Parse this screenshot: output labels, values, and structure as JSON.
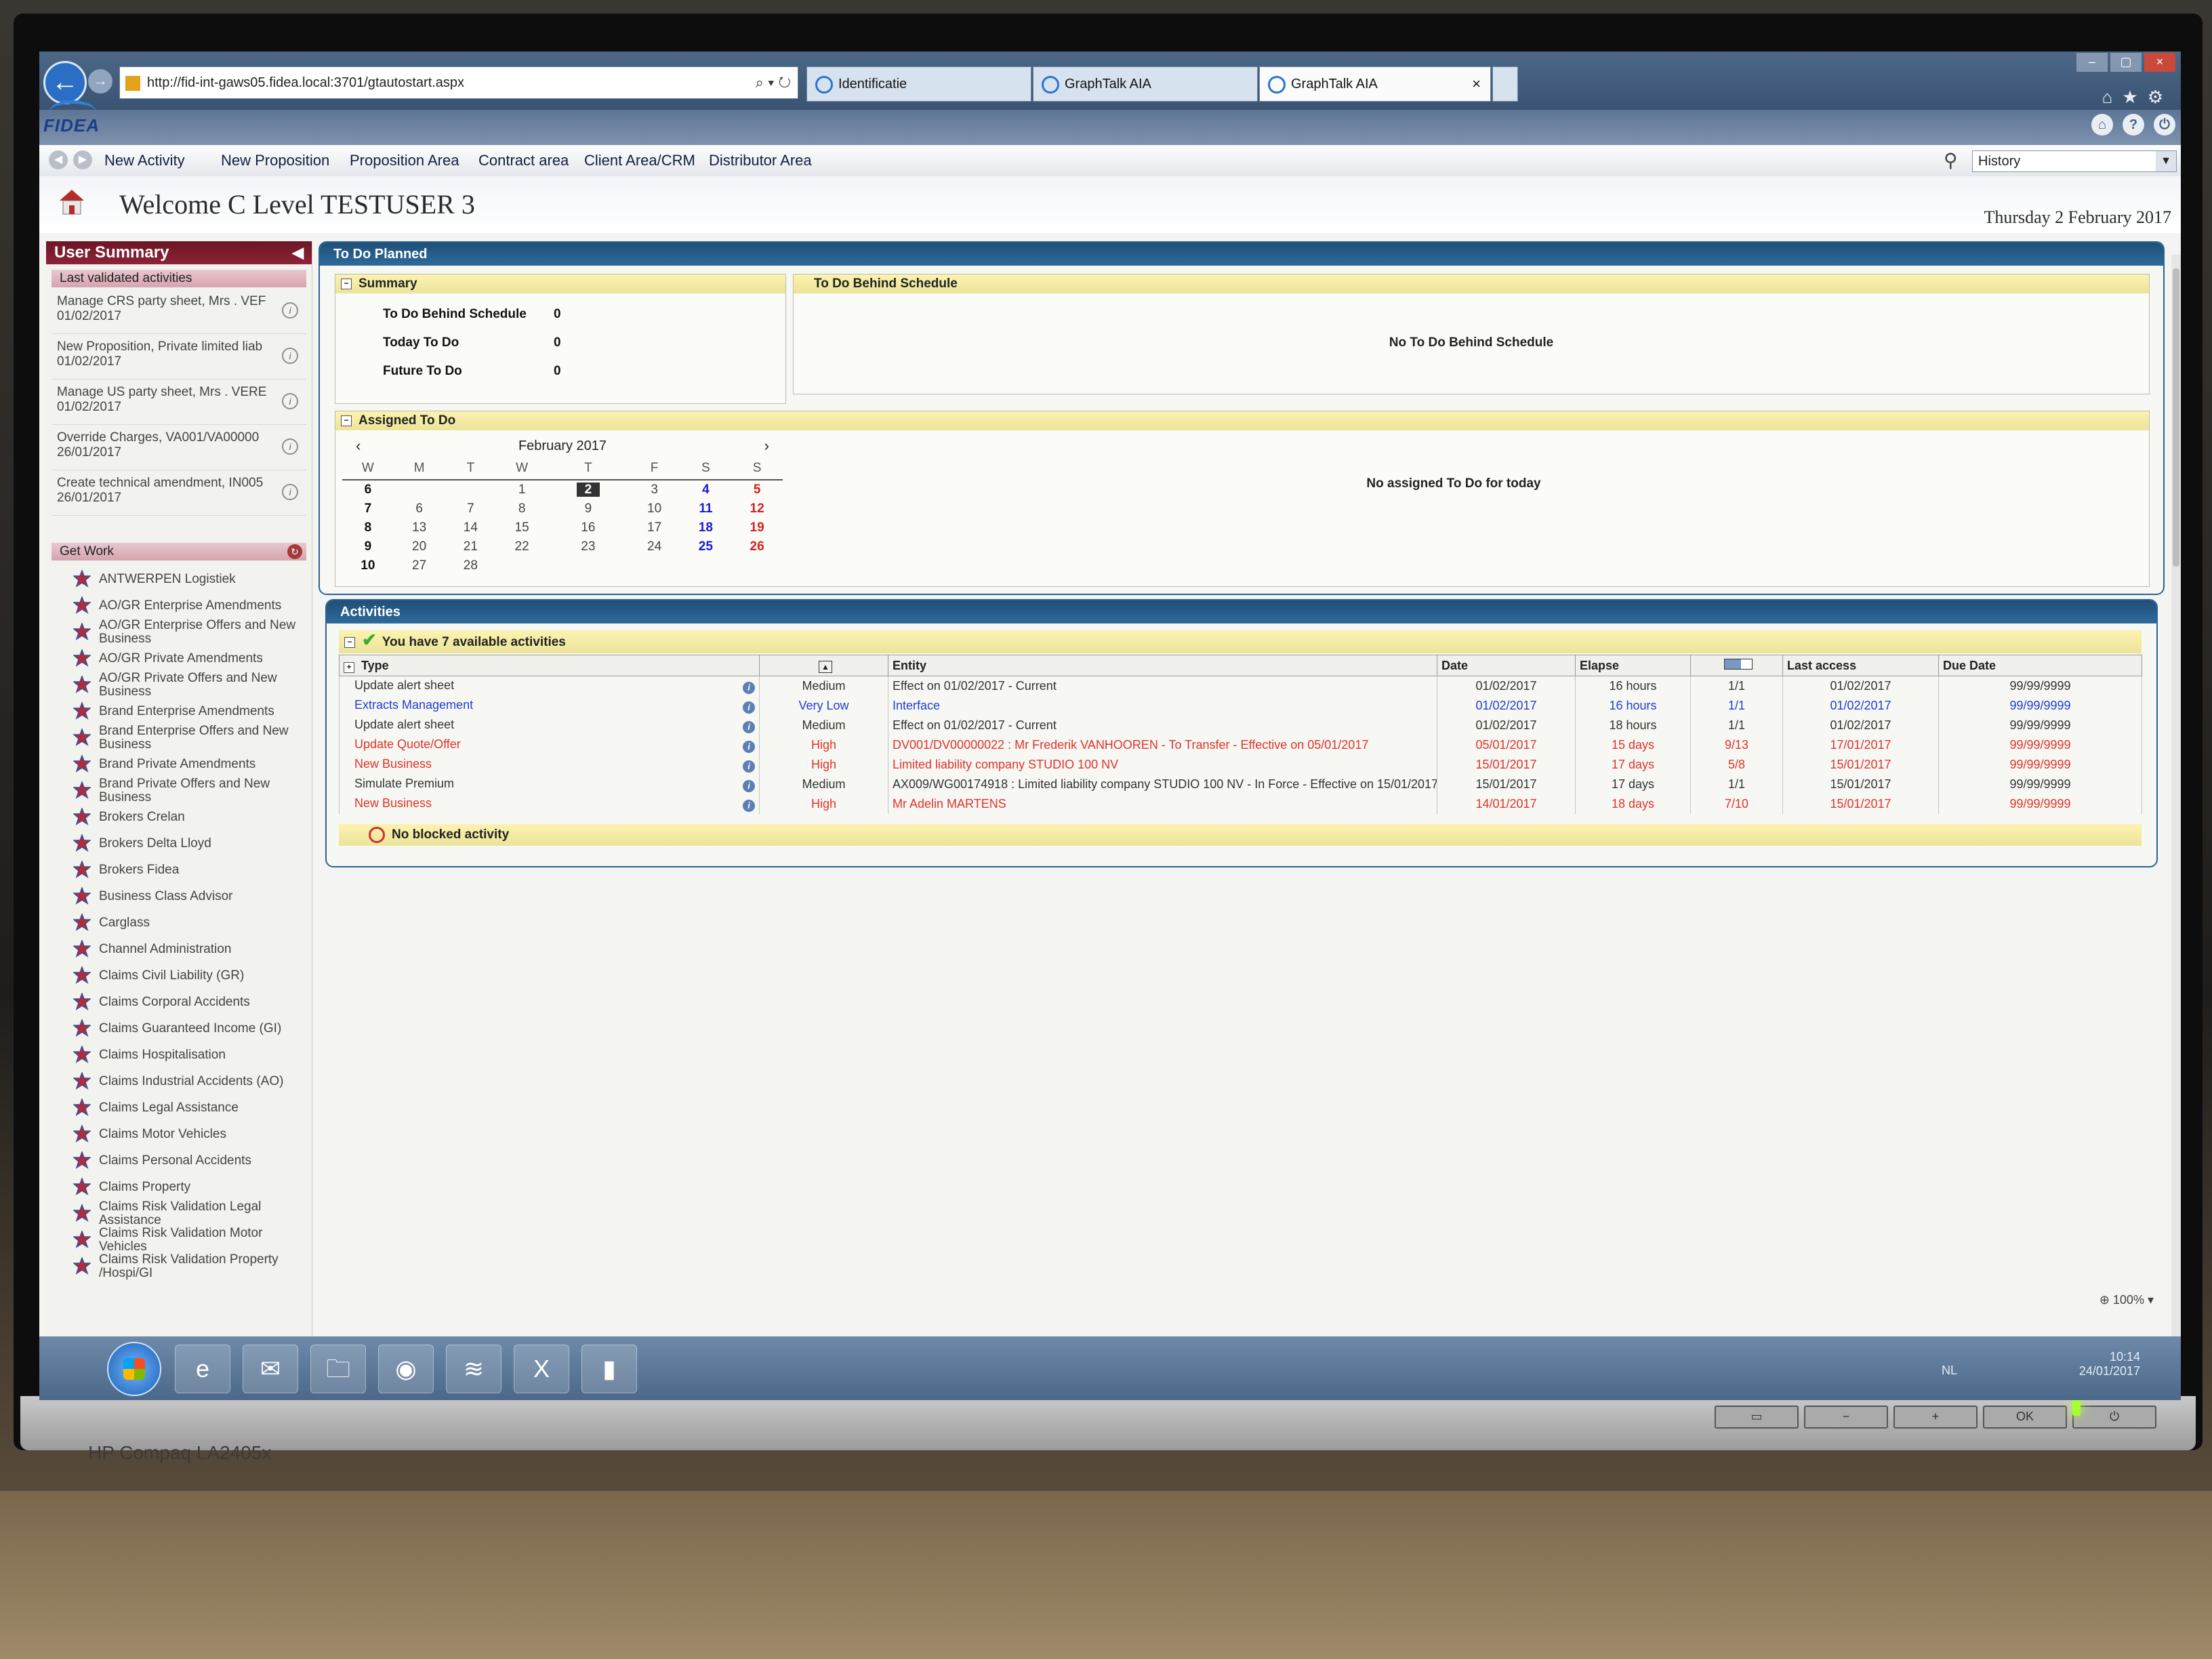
{
  "browser": {
    "url": "http://fid-int-gaws05.fidea.local:3701/gtautostart.aspx",
    "tabs": [
      {
        "label": "Identificatie",
        "active": false
      },
      {
        "label": "GraphTalk AIA",
        "active": false
      },
      {
        "label": "GraphTalk AIA",
        "active": true
      }
    ]
  },
  "app": {
    "logo": "FIDEA",
    "menu": [
      "New Activity",
      "New Proposition",
      "Proposition Area",
      "Contract area",
      "Client Area/CRM",
      "Distributor Area"
    ],
    "history_placeholder": "History",
    "welcome": "Welcome C Level TESTUSER 3",
    "date": "Thursday 2 February 2017"
  },
  "sidebar": {
    "title": "User Summary",
    "last_validated_title": "Last validated activities",
    "recent": [
      {
        "text": "Manage CRS party sheet, Mrs . VEF",
        "date": "01/02/2017"
      },
      {
        "text": "New Proposition, Private limited liab",
        "date": "01/02/2017"
      },
      {
        "text": "Manage US party sheet, Mrs . VERE",
        "date": "01/02/2017"
      },
      {
        "text": "Override Charges, VA001/VA00000",
        "date": "26/01/2017"
      },
      {
        "text": "Create technical amendment, IN005",
        "date": "26/01/2017"
      }
    ],
    "get_work_title": "Get Work",
    "get_work": [
      "ANTWERPEN Logistiek",
      "AO/GR Enterprise Amendments",
      "AO/GR Enterprise Offers and New Business",
      "AO/GR Private Amendments",
      "AO/GR Private Offers and New Business",
      "Brand Enterprise Amendments",
      "Brand Enterprise Offers and New Business",
      "Brand Private Amendments",
      "Brand Private Offers and New Business",
      "Brokers Crelan",
      "Brokers Delta Lloyd",
      "Brokers Fidea",
      "Business Class Advisor",
      "Carglass",
      "Channel Administration",
      "Claims Civil Liability (GR)",
      "Claims Corporal Accidents",
      "Claims Guaranteed Income (GI)",
      "Claims Hospitalisation",
      "Claims Industrial Accidents (AO)",
      "Claims Legal Assistance",
      "Claims Motor Vehicles",
      "Claims Personal Accidents",
      "Claims Property",
      "Claims Risk Validation Legal Assistance",
      "Claims Risk Validation Motor Vehicles",
      "Claims Risk Validation Property /Hospi/GI"
    ]
  },
  "todo": {
    "title": "To Do Planned",
    "summary_title": "Summary",
    "summary": [
      {
        "label": "To Do Behind Schedule",
        "value": "0"
      },
      {
        "label": "Today To Do",
        "value": "0"
      },
      {
        "label": "Future To Do",
        "value": "0"
      }
    ],
    "behind_title": "To Do Behind Schedule",
    "behind_msg": "No To Do Behind Schedule",
    "assigned_title": "Assigned To Do",
    "assigned_msg": "No assigned To Do for today",
    "calendar": {
      "month": "February 2017",
      "headers": [
        "W",
        "M",
        "T",
        "W",
        "T",
        "F",
        "S",
        "S"
      ],
      "weeks": [
        [
          "6",
          "",
          "",
          "1",
          "2",
          "3",
          "4",
          "5"
        ],
        [
          "7",
          "6",
          "7",
          "8",
          "9",
          "10",
          "11",
          "12"
        ],
        [
          "8",
          "13",
          "14",
          "15",
          "16",
          "17",
          "18",
          "19"
        ],
        [
          "9",
          "20",
          "21",
          "22",
          "23",
          "24",
          "25",
          "26"
        ],
        [
          "10",
          "27",
          "28",
          "",
          "",
          "",
          "",
          ""
        ]
      ],
      "today": "2"
    }
  },
  "activities": {
    "title": "Activities",
    "available": "You have 7 available activities",
    "columns": [
      "Type",
      "",
      "",
      "Entity",
      "Date",
      "Elapse",
      "",
      "Last access",
      "Due Date"
    ],
    "rows": [
      {
        "type": "Update alert sheet",
        "priority": "Medium",
        "entity": "Effect on 01/02/2017 - Current",
        "date": "01/02/2017",
        "elapse": "16 hours",
        "ratio": "1/1",
        "last": "01/02/2017",
        "due": "99/99/9999",
        "style": "normal"
      },
      {
        "type": "Extracts Management",
        "priority": "Very Low",
        "entity": "Interface",
        "date": "01/02/2017",
        "elapse": "16 hours",
        "ratio": "1/1",
        "last": "01/02/2017",
        "due": "99/99/9999",
        "style": "blue"
      },
      {
        "type": "Update alert sheet",
        "priority": "Medium",
        "entity": "Effect on 01/02/2017 - Current",
        "date": "01/02/2017",
        "elapse": "18 hours",
        "ratio": "1/1",
        "last": "01/02/2017",
        "due": "99/99/9999",
        "style": "normal"
      },
      {
        "type": "Update Quote/Offer",
        "priority": "High",
        "entity": "DV001/DV00000022 : Mr Frederik VANHOOREN - To Transfer - Effective on 05/01/2017",
        "date": "05/01/2017",
        "elapse": "15 days",
        "ratio": "9/13",
        "last": "17/01/2017",
        "due": "99/99/9999",
        "style": "red"
      },
      {
        "type": "New Business",
        "priority": "High",
        "entity": "Limited liability company STUDIO 100 NV",
        "date": "15/01/2017",
        "elapse": "17 days",
        "ratio": "5/8",
        "last": "15/01/2017",
        "due": "99/99/9999",
        "style": "red"
      },
      {
        "type": "Simulate Premium",
        "priority": "Medium",
        "entity": "AX009/WG00174918 : Limited liability company STUDIO 100 NV - In Force - Effective on 15/01/2017",
        "date": "15/01/2017",
        "elapse": "17 days",
        "ratio": "1/1",
        "last": "15/01/2017",
        "due": "99/99/9999",
        "style": "normal"
      },
      {
        "type": "New Business",
        "priority": "High",
        "entity": "Mr Adelin MARTENS",
        "date": "14/01/2017",
        "elapse": "18 days",
        "ratio": "7/10",
        "last": "15/01/2017",
        "due": "99/99/9999",
        "style": "red"
      }
    ],
    "blocked": "No blocked activity"
  },
  "status": {
    "zoom": "100%"
  },
  "taskbar": {
    "lang": "NL",
    "time": "10:14",
    "date": "24/01/2017"
  },
  "monitor": {
    "brand": "HP Compaq LA2405x"
  }
}
